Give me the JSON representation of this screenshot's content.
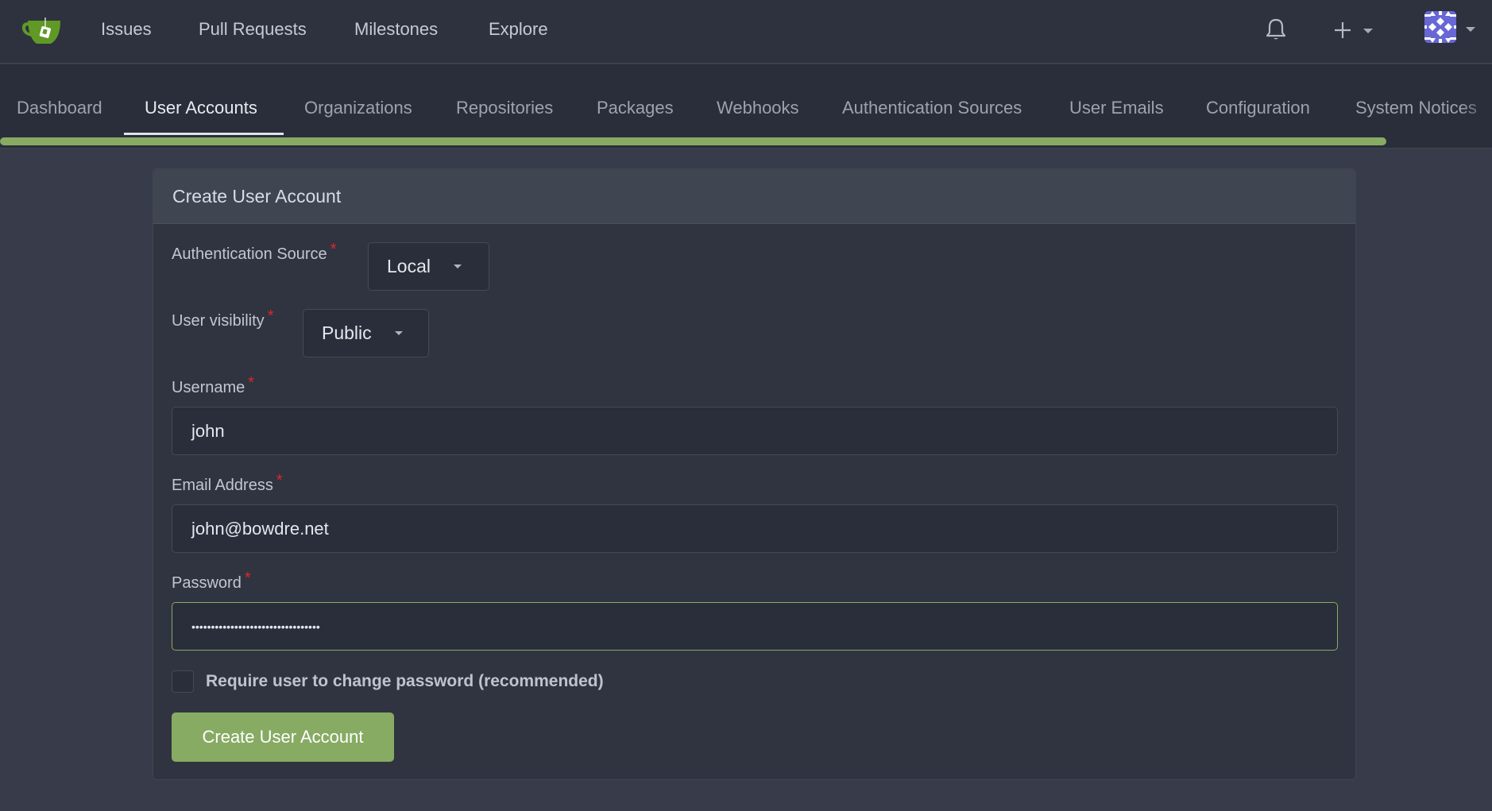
{
  "topnav": {
    "items": [
      {
        "label": "Issues"
      },
      {
        "label": "Pull Requests"
      },
      {
        "label": "Milestones"
      },
      {
        "label": "Explore"
      }
    ],
    "icons": {
      "logo": "gitea-teacup-logo",
      "notifications": "bell-icon",
      "create": "plus-icon",
      "avatar": "user-avatar"
    }
  },
  "admin_tabs": {
    "items": [
      {
        "label": "Dashboard"
      },
      {
        "label": "User Accounts",
        "active": true
      },
      {
        "label": "Organizations"
      },
      {
        "label": "Repositories"
      },
      {
        "label": "Packages"
      },
      {
        "label": "Webhooks"
      },
      {
        "label": "Authentication Sources"
      },
      {
        "label": "User Emails"
      },
      {
        "label": "Configuration"
      },
      {
        "label": "System Notices"
      }
    ]
  },
  "form": {
    "title": "Create User Account",
    "auth_source": {
      "label": "Authentication Source",
      "value": "Local"
    },
    "visibility": {
      "label": "User visibility",
      "value": "Public"
    },
    "username": {
      "label": "Username",
      "value": "john"
    },
    "email": {
      "label": "Email Address",
      "value": "john@bowdre.net"
    },
    "password": {
      "label": "Password",
      "masked_value": "•••••••••••••••••••••••••••••••••",
      "length": 33
    },
    "required_marker": "*",
    "must_change_password": {
      "label": "Require user to change password (recommended)",
      "checked": false
    },
    "submit_label": "Create User Account"
  },
  "colors": {
    "accent": "#87ab63",
    "required": "#db2828",
    "avatar": "#6767d6"
  }
}
